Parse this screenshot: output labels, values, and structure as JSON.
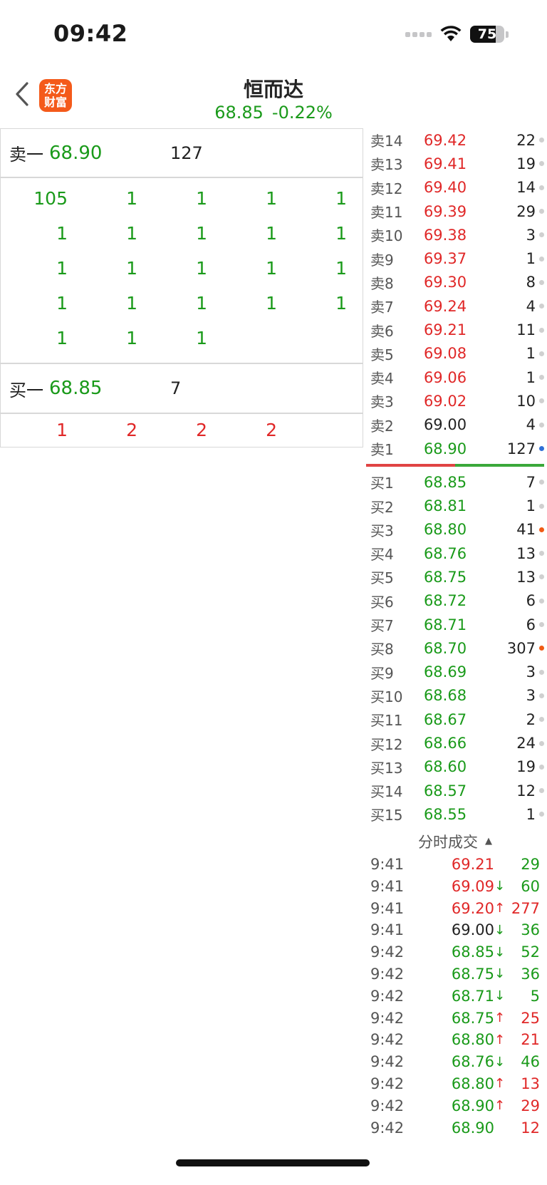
{
  "status_bar": {
    "time": "09:42",
    "battery_level": 75,
    "battery_text": "75",
    "signal_icon": "signal-dots",
    "wifi_icon": "wifi-icon"
  },
  "header": {
    "back_icon": "chevron-left-icon",
    "app_logo_line1": "东方",
    "app_logo_line2": "财富",
    "stock_name": "恒而达",
    "price": "68.85",
    "change_pct": "-0.22%"
  },
  "left_panel": {
    "ask1": {
      "label": "卖一",
      "price": "68.90",
      "qty": "127"
    },
    "ask_queue": [
      "105",
      "1",
      "1",
      "1",
      "1",
      "1",
      "1",
      "1",
      "1",
      "1",
      "1",
      "1",
      "1",
      "1",
      "1",
      "1",
      "1",
      "1",
      "1",
      "1",
      "1",
      "1",
      "1"
    ],
    "bid1": {
      "label": "买一",
      "price": "68.85",
      "qty": "7"
    },
    "bid_queue": [
      "1",
      "2",
      "2",
      "2"
    ]
  },
  "asks": [
    {
      "label": "卖14",
      "price": "69.42",
      "qty": "22",
      "color": "red",
      "dot": "gray"
    },
    {
      "label": "卖13",
      "price": "69.41",
      "qty": "19",
      "color": "red",
      "dot": "gray"
    },
    {
      "label": "卖12",
      "price": "69.40",
      "qty": "14",
      "color": "red",
      "dot": "gray"
    },
    {
      "label": "卖11",
      "price": "69.39",
      "qty": "29",
      "color": "red",
      "dot": "gray"
    },
    {
      "label": "卖10",
      "price": "69.38",
      "qty": "3",
      "color": "red",
      "dot": "gray"
    },
    {
      "label": "卖9",
      "price": "69.37",
      "qty": "1",
      "color": "red",
      "dot": "gray"
    },
    {
      "label": "卖8",
      "price": "69.30",
      "qty": "8",
      "color": "red",
      "dot": "gray"
    },
    {
      "label": "卖7",
      "price": "69.24",
      "qty": "4",
      "color": "red",
      "dot": "gray"
    },
    {
      "label": "卖6",
      "price": "69.21",
      "qty": "11",
      "color": "red",
      "dot": "gray"
    },
    {
      "label": "卖5",
      "price": "69.08",
      "qty": "1",
      "color": "red",
      "dot": "gray"
    },
    {
      "label": "卖4",
      "price": "69.06",
      "qty": "1",
      "color": "red",
      "dot": "gray"
    },
    {
      "label": "卖3",
      "price": "69.02",
      "qty": "10",
      "color": "red",
      "dot": "gray"
    },
    {
      "label": "卖2",
      "price": "69.00",
      "qty": "4",
      "color": "black",
      "dot": "gray"
    },
    {
      "label": "卖1",
      "price": "68.90",
      "qty": "127",
      "color": "green",
      "dot": "blue"
    }
  ],
  "bids": [
    {
      "label": "买1",
      "price": "68.85",
      "qty": "7",
      "color": "green",
      "dot": "gray"
    },
    {
      "label": "买2",
      "price": "68.81",
      "qty": "1",
      "color": "green",
      "dot": "gray"
    },
    {
      "label": "买3",
      "price": "68.80",
      "qty": "41",
      "color": "green",
      "dot": "orange"
    },
    {
      "label": "买4",
      "price": "68.76",
      "qty": "13",
      "color": "green",
      "dot": "gray"
    },
    {
      "label": "买5",
      "price": "68.75",
      "qty": "13",
      "color": "green",
      "dot": "gray"
    },
    {
      "label": "买6",
      "price": "68.72",
      "qty": "6",
      "color": "green",
      "dot": "gray"
    },
    {
      "label": "买7",
      "price": "68.71",
      "qty": "6",
      "color": "green",
      "dot": "gray"
    },
    {
      "label": "买8",
      "price": "68.70",
      "qty": "307",
      "color": "green",
      "dot": "orange"
    },
    {
      "label": "买9",
      "price": "68.69",
      "qty": "3",
      "color": "green",
      "dot": "gray"
    },
    {
      "label": "买10",
      "price": "68.68",
      "qty": "3",
      "color": "green",
      "dot": "gray"
    },
    {
      "label": "买11",
      "price": "68.67",
      "qty": "2",
      "color": "green",
      "dot": "gray"
    },
    {
      "label": "买12",
      "price": "68.66",
      "qty": "24",
      "color": "green",
      "dot": "gray"
    },
    {
      "label": "买13",
      "price": "68.60",
      "qty": "19",
      "color": "green",
      "dot": "gray"
    },
    {
      "label": "买14",
      "price": "68.57",
      "qty": "12",
      "color": "green",
      "dot": "gray"
    },
    {
      "label": "买15",
      "price": "68.55",
      "qty": "1",
      "color": "green",
      "dot": "gray"
    }
  ],
  "divider_ratio": {
    "red": 0.5,
    "green": 0.5
  },
  "trades": {
    "title": "分时成交",
    "rows": [
      {
        "time": "9:41",
        "price": "69.21",
        "arrow": "",
        "price_color": "red",
        "vol": "29",
        "vol_color": "green"
      },
      {
        "time": "9:41",
        "price": "69.09",
        "arrow": "↓",
        "price_color": "red",
        "vol": "60",
        "vol_color": "green"
      },
      {
        "time": "9:41",
        "price": "69.20",
        "arrow": "↑",
        "price_color": "red",
        "vol": "277",
        "vol_color": "red"
      },
      {
        "time": "9:41",
        "price": "69.00",
        "arrow": "↓",
        "price_color": "black",
        "vol": "36",
        "vol_color": "green"
      },
      {
        "time": "9:42",
        "price": "68.85",
        "arrow": "↓",
        "price_color": "green",
        "vol": "52",
        "vol_color": "green"
      },
      {
        "time": "9:42",
        "price": "68.75",
        "arrow": "↓",
        "price_color": "green",
        "vol": "36",
        "vol_color": "green"
      },
      {
        "time": "9:42",
        "price": "68.71",
        "arrow": "↓",
        "price_color": "green",
        "vol": "5",
        "vol_color": "green"
      },
      {
        "time": "9:42",
        "price": "68.75",
        "arrow": "↑",
        "price_color": "green",
        "vol": "25",
        "vol_color": "red"
      },
      {
        "time": "9:42",
        "price": "68.80",
        "arrow": "↑",
        "price_color": "green",
        "vol": "21",
        "vol_color": "red"
      },
      {
        "time": "9:42",
        "price": "68.76",
        "arrow": "↓",
        "price_color": "green",
        "vol": "46",
        "vol_color": "green"
      },
      {
        "time": "9:42",
        "price": "68.80",
        "arrow": "↑",
        "price_color": "green",
        "vol": "13",
        "vol_color": "red"
      },
      {
        "time": "9:42",
        "price": "68.90",
        "arrow": "↑",
        "price_color": "green",
        "vol": "29",
        "vol_color": "red"
      },
      {
        "time": "9:42",
        "price": "68.90",
        "arrow": "",
        "price_color": "green",
        "vol": "12",
        "vol_color": "red"
      }
    ]
  },
  "colors": {
    "red": "#e02828",
    "green": "#1a9a1a",
    "black": "#222222",
    "dot_gray": "#d0d0d0",
    "dot_blue": "#2f6fd6",
    "dot_orange": "#f05a14",
    "logo": "#f45a1a"
  }
}
